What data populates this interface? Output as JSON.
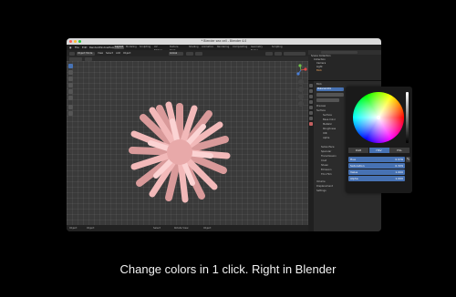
{
  "window": {
    "title": "* Blender sea cell - Blender 4.0"
  },
  "menubar": [
    "File",
    "Edit",
    "Render",
    "Window",
    "Help"
  ],
  "workspace_tabs": [
    "Layout",
    "Modeling",
    "Sculpting",
    "UV Editing",
    "Texture Paint",
    "Shading",
    "Animation",
    "Rendering",
    "Compositing",
    "Geometry Nodes",
    "Scripting"
  ],
  "viewport": {
    "mode": "Object Mode",
    "menus": [
      "View",
      "Select",
      "Add",
      "Object"
    ],
    "orientation": "Global",
    "footer": [
      "Object",
      "Object",
      "Select",
      "Rotate View",
      "Object"
    ]
  },
  "outliner": {
    "search": "",
    "rows": [
      "Scene Collection",
      "Collection",
      "Camera",
      "Light",
      "Blob"
    ]
  },
  "properties": {
    "object_name": "Blob",
    "material_name": "Material.001",
    "rows": [
      "Preview",
      "Surface",
      "Surface",
      "Base Color",
      "Metallic",
      "Roughness",
      "IOR",
      "Alpha",
      "Subsurface",
      "Specular",
      "Transmission",
      "Coat",
      "Sheen",
      "Emission",
      "Thin Film",
      "Volume",
      "Displacement",
      "Settings"
    ]
  },
  "color_picker": {
    "modes": [
      "RGB",
      "HSV",
      "HSL"
    ],
    "active_mode": "HSV",
    "fields": [
      {
        "label": "Hue",
        "value": "0.976"
      },
      {
        "label": "Saturation",
        "value": "0.329"
      },
      {
        "label": "Value",
        "value": "1.000"
      },
      {
        "label": "Alpha",
        "value": "1.000"
      }
    ]
  },
  "caption": "Change colors in 1 click. Right in Blender",
  "colors": {
    "accent": "#4772b3",
    "object": "#f2b9b9",
    "background": "#000000"
  }
}
